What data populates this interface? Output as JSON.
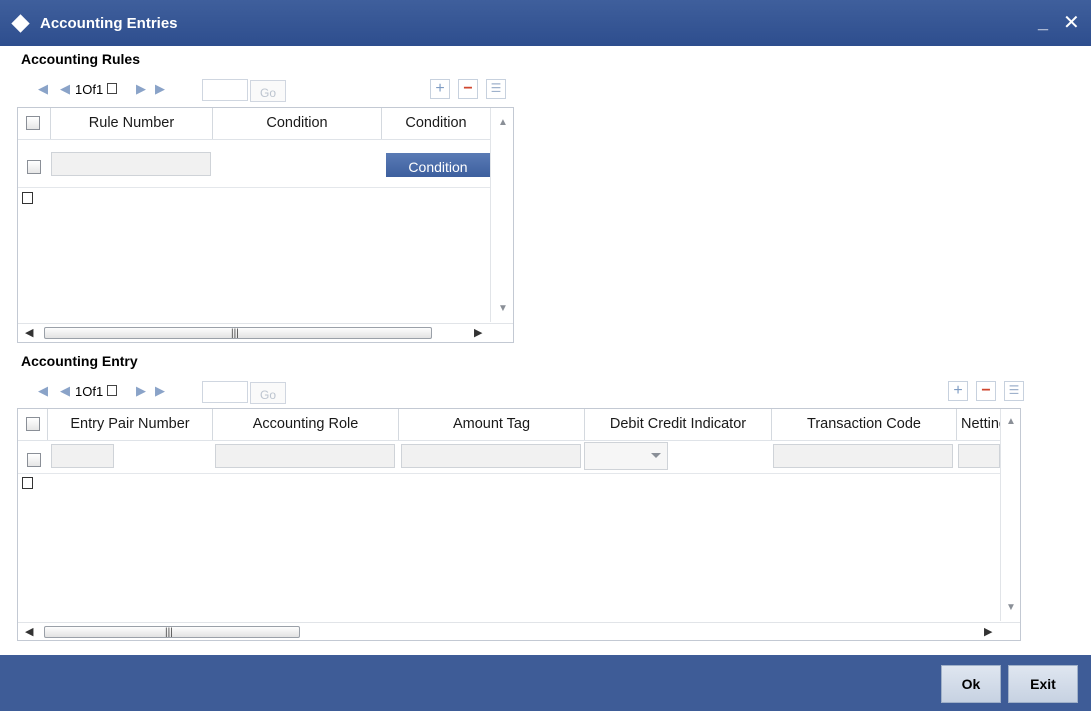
{
  "window": {
    "title": "Accounting Entries",
    "minimize_glyph": "_",
    "close_glyph": "✕"
  },
  "icons": {
    "title": "diamond-icon",
    "first": "first-page-icon",
    "prev": "previous-page-icon",
    "next": "next-page-icon",
    "last": "last-page-icon",
    "add": "add-row-icon",
    "delete": "delete-row-icon",
    "view": "single-view-icon"
  },
  "rules": {
    "label": "Accounting Rules",
    "pager": {
      "text": "1Of1",
      "go_label": "Go"
    },
    "columns": [
      "Rule Number",
      "Condition",
      "Condition"
    ],
    "rows": [
      {
        "rule_number": "",
        "condition": "",
        "condition_button": "Condition"
      }
    ]
  },
  "entry": {
    "label": "Accounting Entry",
    "pager": {
      "text": "1Of1",
      "go_label": "Go"
    },
    "columns": [
      "Entry Pair Number",
      "Accounting Role",
      "Amount Tag",
      "Debit Credit Indicator",
      "Transaction Code",
      "Netting"
    ],
    "rows": [
      {
        "entry_pair_number": "",
        "accounting_role": "",
        "amount_tag": "",
        "debit_credit_indicator": "",
        "transaction_code": "",
        "netting": ""
      }
    ]
  },
  "buttons": {
    "ok": "Ok",
    "exit": "Exit"
  },
  "colors": {
    "titlebar": "#2e4e8e",
    "bottombar": "#3e5c97",
    "button": "#4a6aa7"
  }
}
